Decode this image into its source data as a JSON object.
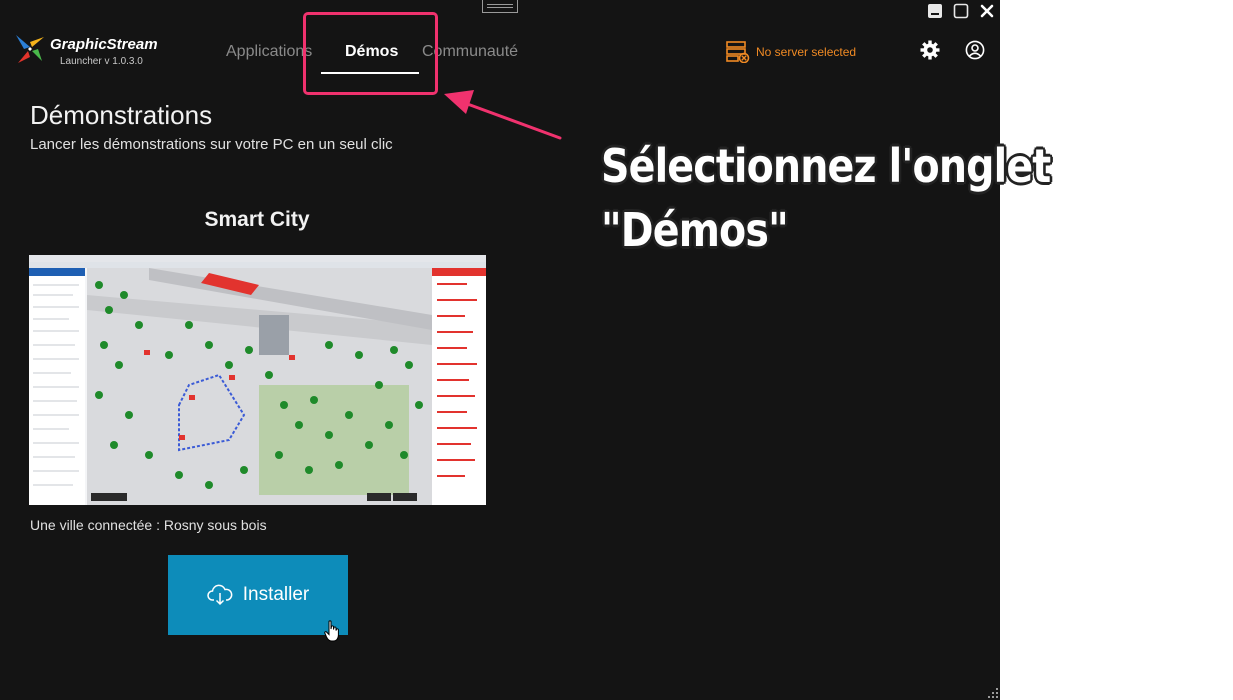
{
  "brand": {
    "name": "GraphicStream",
    "version": "Launcher v 1.0.3.0"
  },
  "tabs": [
    {
      "label": "Applications",
      "active": false
    },
    {
      "label": "Démos",
      "active": true
    },
    {
      "label": "Communauté",
      "active": false
    }
  ],
  "server": {
    "status_label": "No server selected",
    "color": "#f08a24"
  },
  "page": {
    "title": "Démonstrations",
    "subtitle": "Lancer les démonstrations sur votre PC en un seul clic"
  },
  "demo": {
    "title": "Smart City",
    "description": "Une ville connectée : Rosny sous bois",
    "install_label": "Installer"
  },
  "annotation": {
    "line1": "Sélectionnez l'onglet",
    "line2": "\"Démos\""
  },
  "colors": {
    "accent": "#0d8cba",
    "highlight": "#f0326e",
    "background": "#141414"
  },
  "icons": [
    "logo-icon",
    "minimize-icon",
    "maximize-icon",
    "close-icon",
    "server-icon",
    "gear-icon",
    "user-icon",
    "cloud-download-icon",
    "hand-cursor-icon",
    "resize-grip-icon"
  ]
}
